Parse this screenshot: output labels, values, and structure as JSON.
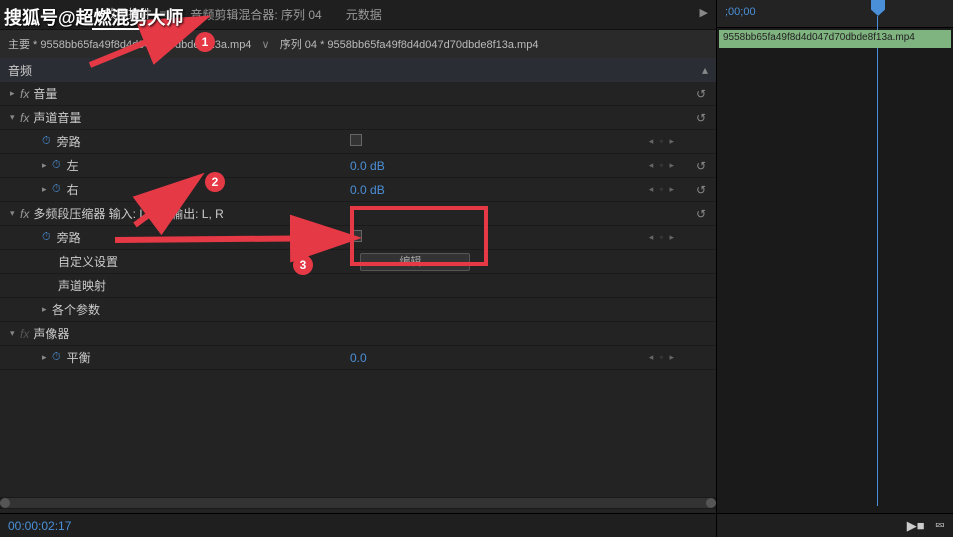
{
  "watermark": "搜狐号@超燃混剪大师",
  "tabs": {
    "effects": "效果控件",
    "mixer": "音频剪辑混合器: 序列 04",
    "metadata": "元数据"
  },
  "breadcrumb": {
    "main": "主要 * 9558bb65fa49f8d4d047d70dbde8f13a.mp4",
    "seq": "序列 04 * 9558bb65fa49f8d4d047d70dbde8f13a.mp4"
  },
  "sections": {
    "audio": "音频",
    "volume": "音量",
    "channel_volume": "声道音量",
    "bypass": "旁路",
    "left": "左",
    "right": "右",
    "multiband": "多频段压缩器 输入: L, R | 输出: L, R",
    "custom": "自定义设置",
    "channel_map": "声道映射",
    "params": "各个参数",
    "panner": "声像器",
    "balance": "平衡"
  },
  "values": {
    "db_left": "0.0 dB",
    "db_right": "0.0 dB",
    "balance": "0.0",
    "edit": "编辑..."
  },
  "timeline": {
    "start": ";00;00",
    "clip": "9558bb65fa49f8d4d047d70dbde8f13a.mp4"
  },
  "timecode": "00:00:02:17",
  "annotations": {
    "m1": "1",
    "m2": "2",
    "m3": "3"
  }
}
